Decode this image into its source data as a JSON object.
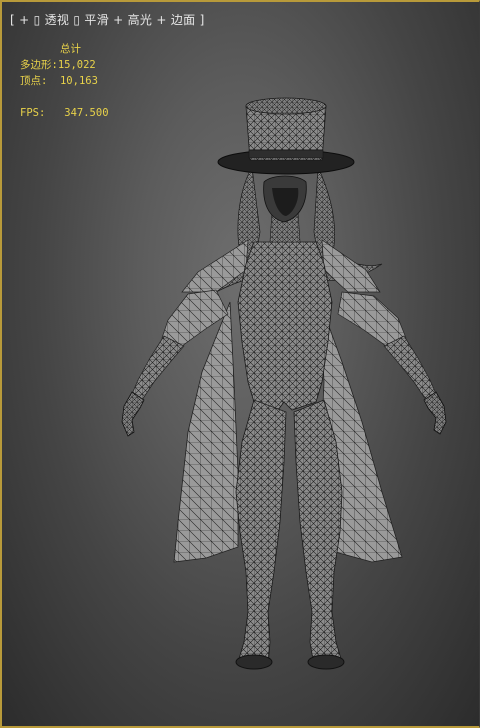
{
  "viewport": {
    "label": {
      "open_bracket": "[",
      "plus1": "+",
      "sep1": "▯",
      "view_mode": "透视",
      "sep2": "▯",
      "shading": "平滑",
      "plus2": "+",
      "highlight": "高光",
      "plus3": "+",
      "edged_faces": "边面",
      "close_bracket": "]"
    },
    "stats": {
      "header": "总计",
      "polys_label": "多边形:",
      "polys_value": "15,022",
      "verts_label": "顶点:",
      "verts_value": "10,163",
      "fps_label": "FPS:",
      "fps_value": "347.500"
    },
    "colors": {
      "border_active": "#b89a3a",
      "stats_text": "#e8d24a",
      "label_text": "#e6e6e6",
      "mesh_fill": "#8a8a8a",
      "wire": "#1a1a1a"
    }
  }
}
